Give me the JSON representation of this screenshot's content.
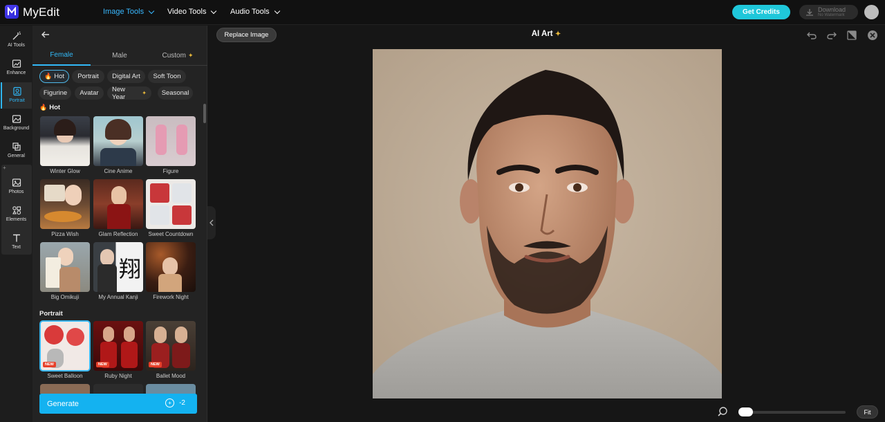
{
  "app": {
    "brand": "MyEdit"
  },
  "nav": {
    "image_tools": "Image Tools",
    "video_tools": "Video Tools",
    "audio_tools": "Audio Tools"
  },
  "header": {
    "get_credits": "Get Credits",
    "download": "Download",
    "download_sub": "No Watermark"
  },
  "rail": {
    "ai_tools": "AI Tools",
    "enhance": "Enhance",
    "portrait": "Portrait",
    "background": "Background",
    "general": "General",
    "photos": "Photos",
    "elements": "Elements",
    "text": "Text"
  },
  "panel": {
    "tabs": [
      "Female",
      "Male",
      "Custom"
    ],
    "chips": [
      "Hot",
      "Portrait",
      "Digital Art",
      "Soft Toon",
      "Figurine",
      "Avatar",
      "New Year",
      "Seasonal"
    ],
    "section_hot": "Hot",
    "section_portrait": "Portrait",
    "hot_items": [
      "Winter Glow",
      "Cine Anime",
      "Figure",
      "Pizza Wish",
      "Glam Reflection",
      "Sweet Countdown",
      "Big Omikuji",
      "My Annual Kanji",
      "Firework Night"
    ],
    "portrait_items": [
      "Sweet Balloon",
      "Ruby Night",
      "Ballet Mood"
    ],
    "new_badge": "NEW",
    "kanji_glyph": "翔"
  },
  "generate": {
    "label": "Generate",
    "cost": "-2"
  },
  "canvas": {
    "replace_image": "Replace Image",
    "title": "AI Art",
    "fit": "Fit",
    "zoom_level": 0
  },
  "colors": {
    "accent": "#32b9f8",
    "credits": "#1fc7da",
    "generate": "#14b2f0",
    "new_badge": "#e7402a"
  },
  "icons": [
    "magic-wand-icon",
    "enhance-icon",
    "portrait-icon",
    "background-icon",
    "general-icon",
    "photos-icon",
    "elements-icon",
    "text-icon",
    "undo-icon",
    "redo-icon",
    "compare-icon",
    "close-icon",
    "zoom-icon",
    "download-icon",
    "back-arrow-icon"
  ]
}
